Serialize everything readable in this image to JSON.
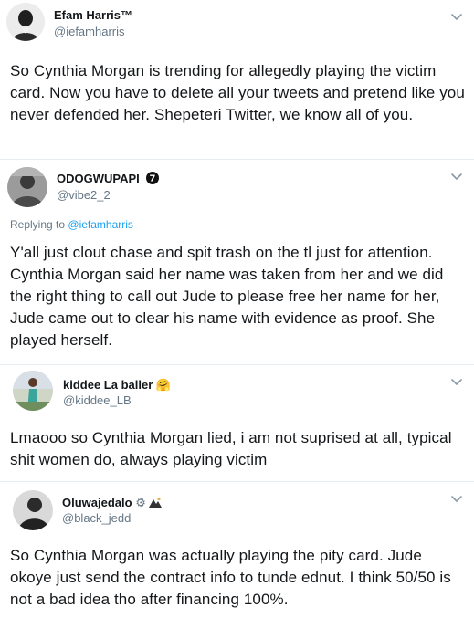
{
  "tweets": [
    {
      "name": "Efam Harris™",
      "handle": "@iefamharris",
      "body": "So Cynthia Morgan is trending for allegedly playing the victim card. Now you have to delete all your tweets and pretend like you never defended her. Shepeteri Twitter, we know all of you."
    },
    {
      "name": "ODOGWUPAPI",
      "badge": "7",
      "handle": "@vibe2_2",
      "replying_prefix": "Replying to",
      "replying_to": "@iefamharris",
      "body": "Y'all just clout chase and spit trash on the tl just for attention. Cynthia Morgan said her name was taken from her and we did the right thing to call out Jude to please free her name for her, Jude came out to clear his name with evidence as proof. She played herself."
    },
    {
      "name": "kiddee La baller",
      "name_emoji": "🤗",
      "handle": "@kiddee_LB",
      "body": "Lmaooo so Cynthia Morgan lied, i am not suprised at all, typical shit women do,  always playing victim"
    },
    {
      "name": "Oluwajedalo",
      "name_emoji": "⚙",
      "handle": "@black_jedd",
      "body": "So Cynthia Morgan was actually playing the pity card. Jude okoye just send the contract info to tunde ednut. I think 50/50 is not a bad idea tho after financing 100%."
    }
  ],
  "icons": {
    "chevron": "chevron-down-icon",
    "badge7": "number-seven-badge-icon"
  },
  "colors": {
    "link": "#1da1f2",
    "secondary": "#657786",
    "text": "#14171a",
    "divider": "#e6ecf0"
  }
}
